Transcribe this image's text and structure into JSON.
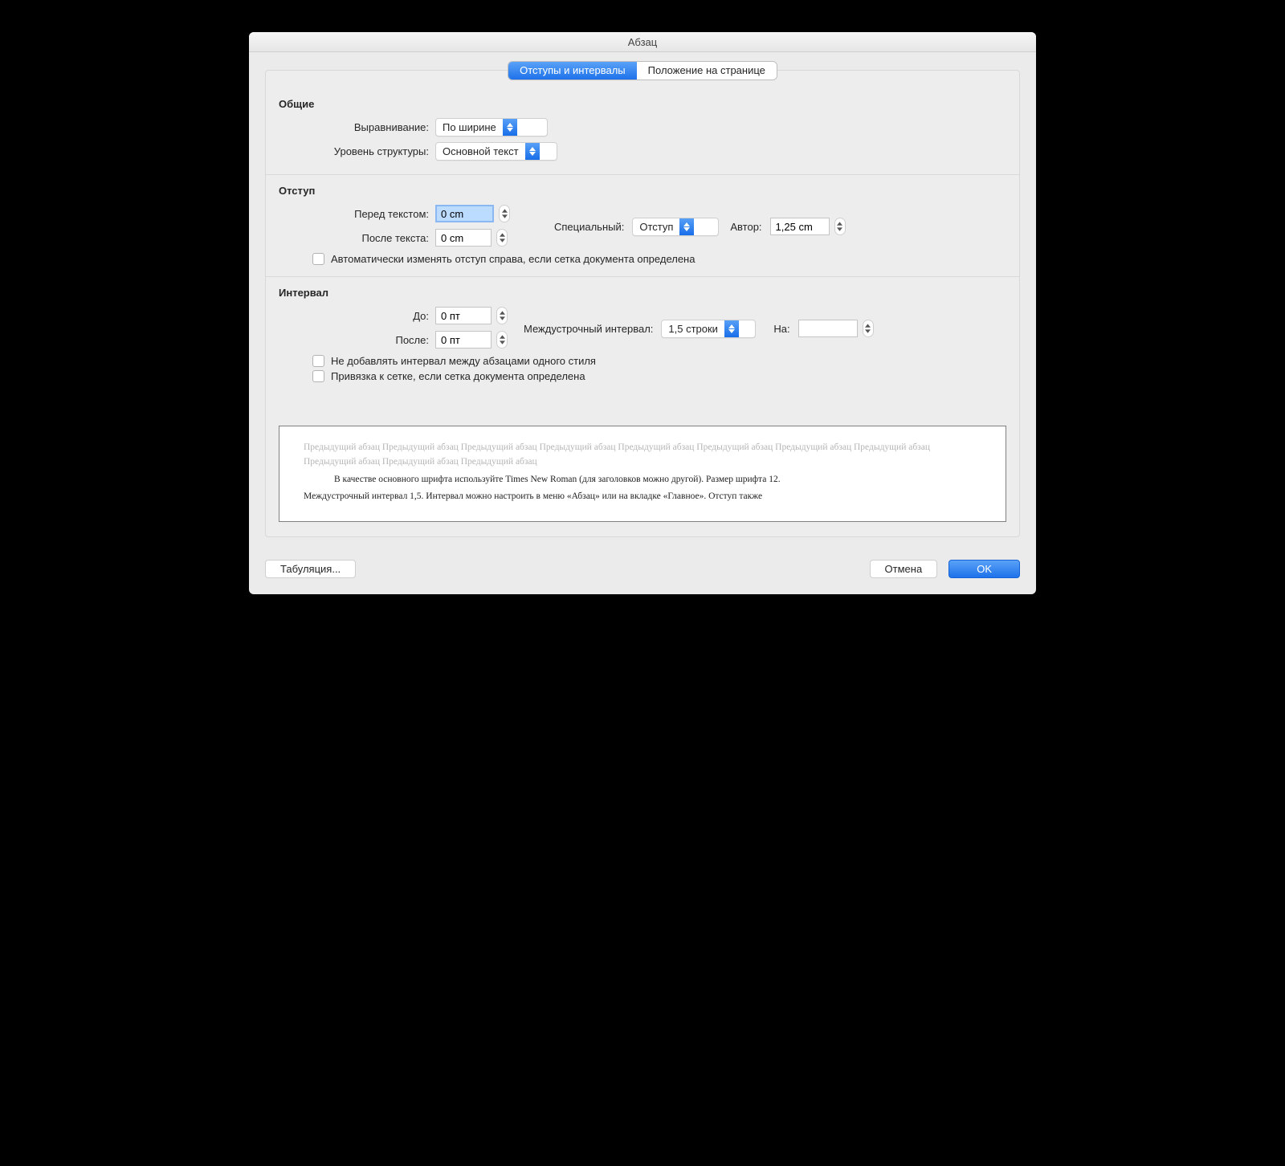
{
  "window": {
    "title": "Абзац"
  },
  "tabs": {
    "active": "Отступы и интервалы",
    "other": "Положение на странице"
  },
  "general": {
    "heading": "Общие",
    "alignment_label": "Выравнивание:",
    "alignment_value": "По ширине",
    "outline_label": "Уровень структуры:",
    "outline_value": "Основной текст"
  },
  "indent": {
    "heading": "Отступ",
    "before_label": "Перед текстом:",
    "before_value": "0 cm",
    "after_label": "После текста:",
    "after_value": "0 cm",
    "special_label": "Специальный:",
    "special_value": "Отступ",
    "by_label": "Автор:",
    "by_value": "1,25 cm",
    "auto_checkbox": "Автоматически изменять отступ справа, если сетка документа определена"
  },
  "spacing": {
    "heading": "Интервал",
    "before_label": "До:",
    "before_value": "0 пт",
    "after_label": "После:",
    "after_value": "0 пт",
    "line_label": "Междустрочный интервал:",
    "line_value": "1,5 строки",
    "at_label": "На:",
    "at_value": "",
    "check1": "Не добавлять интервал между абзацами одного стиля",
    "check2": "Привязка к сетке, если сетка документа определена"
  },
  "preview": {
    "prev": "Предыдущий абзац Предыдущий абзац Предыдущий абзац Предыдущий абзац Предыдущий абзац Предыдущий абзац Предыдущий абзац Предыдущий абзац Предыдущий абзац Предыдущий абзац Предыдущий абзац",
    "body1": "В качестве основного шрифта используйте Times New Roman (для заголовков можно другой). Размер шрифта 12.",
    "body2": "Междустрочный интервал 1,5. Интервал можно настроить в меню «Абзац» или на вкладке «Главное». Отступ также"
  },
  "footer": {
    "tabs": "Табуляция...",
    "cancel": "Отмена",
    "ok": "OK"
  }
}
